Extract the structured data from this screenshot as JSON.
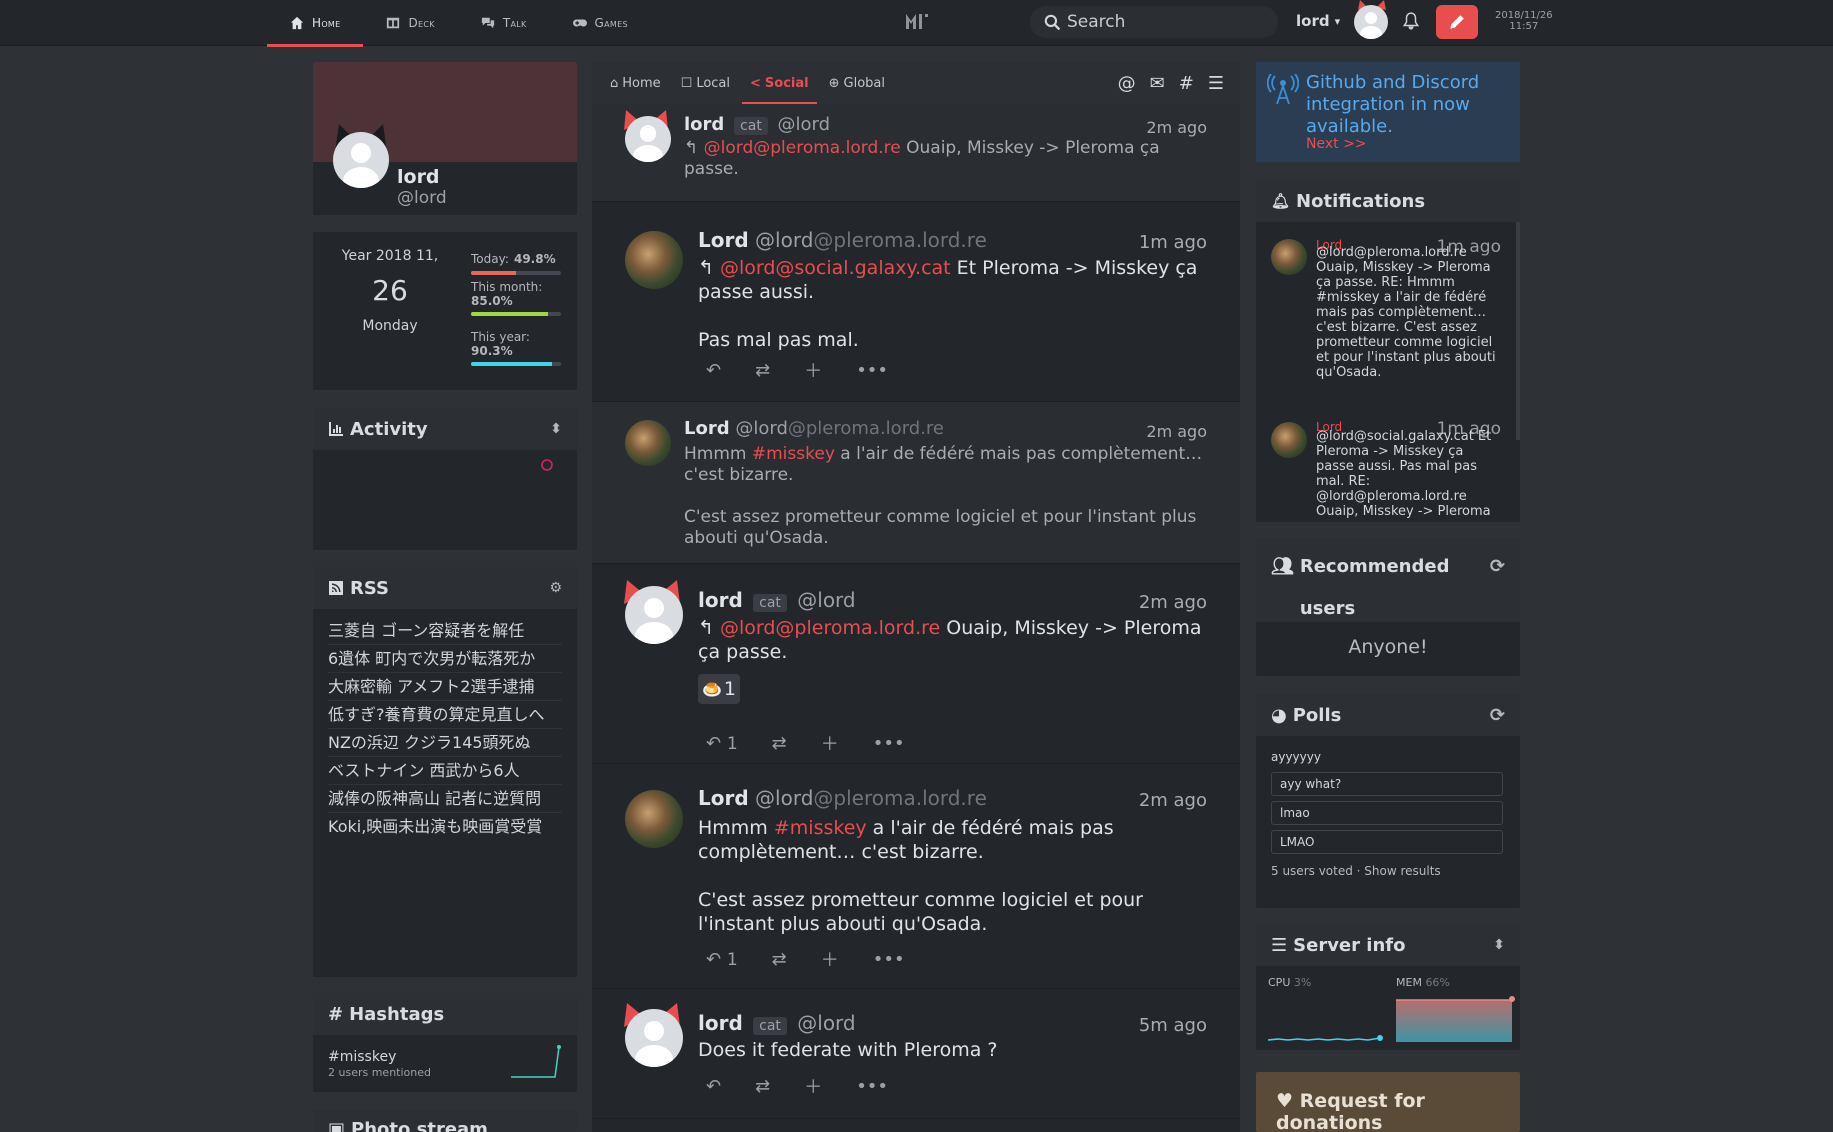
{
  "nav": {
    "items": [
      {
        "label": "Home",
        "icon": "home-icon",
        "active": true
      },
      {
        "label": "Deck",
        "icon": "columns-icon",
        "active": false
      },
      {
        "label": "Talk",
        "icon": "comments-icon",
        "active": false
      },
      {
        "label": "Games",
        "icon": "gamepad-icon",
        "active": false
      }
    ],
    "search_placeholder": "Search",
    "username": "lord",
    "date": "2018/11/26",
    "time": "11:57"
  },
  "profile": {
    "name": "lord",
    "handle": "@lord"
  },
  "calendar": {
    "year_line": "Year 2018  11,",
    "day": "26",
    "weekday": "Monday",
    "today_label": "Today:",
    "today_val": "49.8%",
    "today_frac": 0.498,
    "month_label": "This month:",
    "month_val": "85.0%",
    "month_frac": 0.85,
    "year_label": "This year:",
    "year_val": "90.3%",
    "year_frac": 0.903
  },
  "activity": {
    "title": "Activity"
  },
  "rss": {
    "title": "RSS",
    "items": [
      "三菱自 ゴーン容疑者を解任",
      "6遺体 町内で次男が転落死か",
      "大麻密輸 アメフト2選手逮捕",
      "低すぎ?養育費の算定見直しへ",
      "NZの浜辺 クジラ145頭死ぬ",
      "ベストナイン 西武から6人",
      "減俸の阪神高山 記者に逆質問",
      "Koki,映画未出演も映画賞受賞"
    ]
  },
  "hashtags": {
    "title": "Hashtags",
    "tag": "#misskey",
    "count": "2 users mentioned"
  },
  "photostream": {
    "title": "Photo stream"
  },
  "timeline": {
    "tabs": [
      {
        "label": "Home",
        "icon": "home-icon",
        "active": false
      },
      {
        "label": "Local",
        "icon": "comments-icon",
        "active": false
      },
      {
        "label": "Social",
        "icon": "share-icon",
        "active": true
      },
      {
        "label": "Global",
        "icon": "globe-icon",
        "active": false
      }
    ],
    "notes": [
      {
        "name": "lord",
        "cat": "cat",
        "user": "@lord",
        "host": "",
        "time": "2m ago",
        "mention": "@lord@pleroma.lord.re",
        "text": " Ouaip, Misskey -> Pleroma ça passe."
      },
      {
        "name": "Lord",
        "user": "@lord",
        "host": "@pleroma.lord.re",
        "time": "1m ago",
        "mention": "@lord@social.galaxy.cat",
        "text": " Et Pleroma -> Misskey ça passe aussi.",
        "text2": "Pas mal pas mal."
      },
      {
        "name": "Lord",
        "user": "@lord",
        "host": "@pleroma.lord.re",
        "time": "2m ago",
        "pre": "Hmmm ",
        "tag": "#misskey",
        "text": " a l'air de fédéré mais pas complètement… c'est bizarre.",
        "text2": "C'est assez prometteur comme logiciel et pour l'instant plus abouti qu'Osada."
      },
      {
        "name": "lord",
        "cat": "cat",
        "user": "@lord",
        "host": "",
        "time": "2m ago",
        "mention": "@lord@pleroma.lord.re",
        "text": " Ouaip, Misskey -> Pleroma ça passe.",
        "reaction": "🍮",
        "reaction_count": "1",
        "reply_count": "1"
      },
      {
        "name": "Lord",
        "user": "@lord",
        "host": "@pleroma.lord.re",
        "time": "2m ago",
        "pre": "Hmmm ",
        "tag": "#misskey",
        "text": " a l'air de fédéré mais pas complètement… c'est bizarre.",
        "text2": "C'est assez prometteur comme logiciel et pour l'instant plus abouti qu'Osada.",
        "reply_count": "1"
      },
      {
        "name": "lord",
        "cat": "cat",
        "user": "@lord",
        "host": "",
        "time": "5m ago",
        "text": "Does it federate with Pleroma ?"
      }
    ]
  },
  "announcement": {
    "text": "Github and Discord integration in now available.",
    "link": "Next >>"
  },
  "notifications": {
    "title": "Notifications",
    "items": [
      {
        "name": "Lord",
        "time": "1m ago",
        "text": "@lord@pleroma.lord.re Ouaip, Misskey -> Pleroma ça passe. RE: Hmmm #misskey a l'air de fédéré mais pas complètement… c'est bizarre. C'est assez prometteur comme logiciel et pour l'instant plus abouti qu'Osada."
      },
      {
        "name": "Lord",
        "time": "1m ago",
        "text": "@lord@social.galaxy.cat Et Pleroma -> Misskey ça passe aussi. Pas mal pas mal. RE: @lord@pleroma.lord.re Ouaip, Misskey -> Pleroma"
      }
    ]
  },
  "recommended": {
    "title": "Recommended users",
    "empty": "Anyone!"
  },
  "polls": {
    "title": "Polls",
    "question": "ayyyyyy",
    "options": [
      "ayy what?",
      "lmao",
      "LMAO"
    ],
    "footer": "5 users voted · Show results"
  },
  "server": {
    "title": "Server info",
    "cpu_label": "CPU",
    "cpu_val": "3%",
    "mem_label": "MEM",
    "mem_val": "66%"
  },
  "donations": {
    "title": "Request for donations"
  },
  "colors": {
    "accent": "#e84d50",
    "card": "#23262b",
    "bg": "#2e3136"
  }
}
